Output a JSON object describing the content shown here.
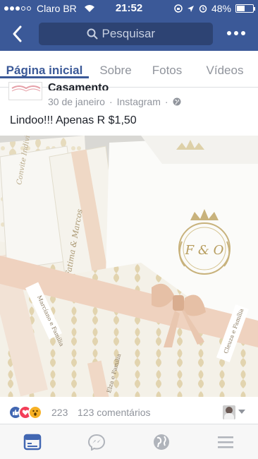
{
  "status_bar": {
    "carrier": "Claro BR",
    "time": "21:52",
    "battery": "48%",
    "battery_level": 0.48,
    "signal_bars": 3
  },
  "nav": {
    "search_placeholder": "Pesquisar",
    "search_value": ""
  },
  "tabs": [
    {
      "label": "Página inicial",
      "active": true
    },
    {
      "label": "Sobre",
      "active": false
    },
    {
      "label": "Fotos",
      "active": false
    },
    {
      "label": "Vídeos",
      "active": false
    }
  ],
  "post": {
    "page_name": "Casamento",
    "date": "30 de janeiro",
    "separator": "·",
    "source": "Instagram",
    "separator2": "·",
    "text": "Lindoo!!! Apenas R $1,50",
    "photo_texts": {
      "card_title": "Convite Individual",
      "names": "Fatima & Marcos",
      "tag_left": "Marcíano e Família",
      "tag_right": "Cleuza e Família",
      "monogram": "F & O",
      "bottom": "Elza e Família"
    }
  },
  "reactions": {
    "count": "223",
    "comments": "123 comentários"
  },
  "colors": {
    "facebook_blue": "#3b5998",
    "search_bg": "#2d4373",
    "muted_text": "#90949c",
    "ribbon": "#e8c9b5",
    "gold": "#c9b27a"
  },
  "bottom_nav_icons": [
    "feed-icon",
    "messenger-icon",
    "globe-icon",
    "menu-icon"
  ]
}
